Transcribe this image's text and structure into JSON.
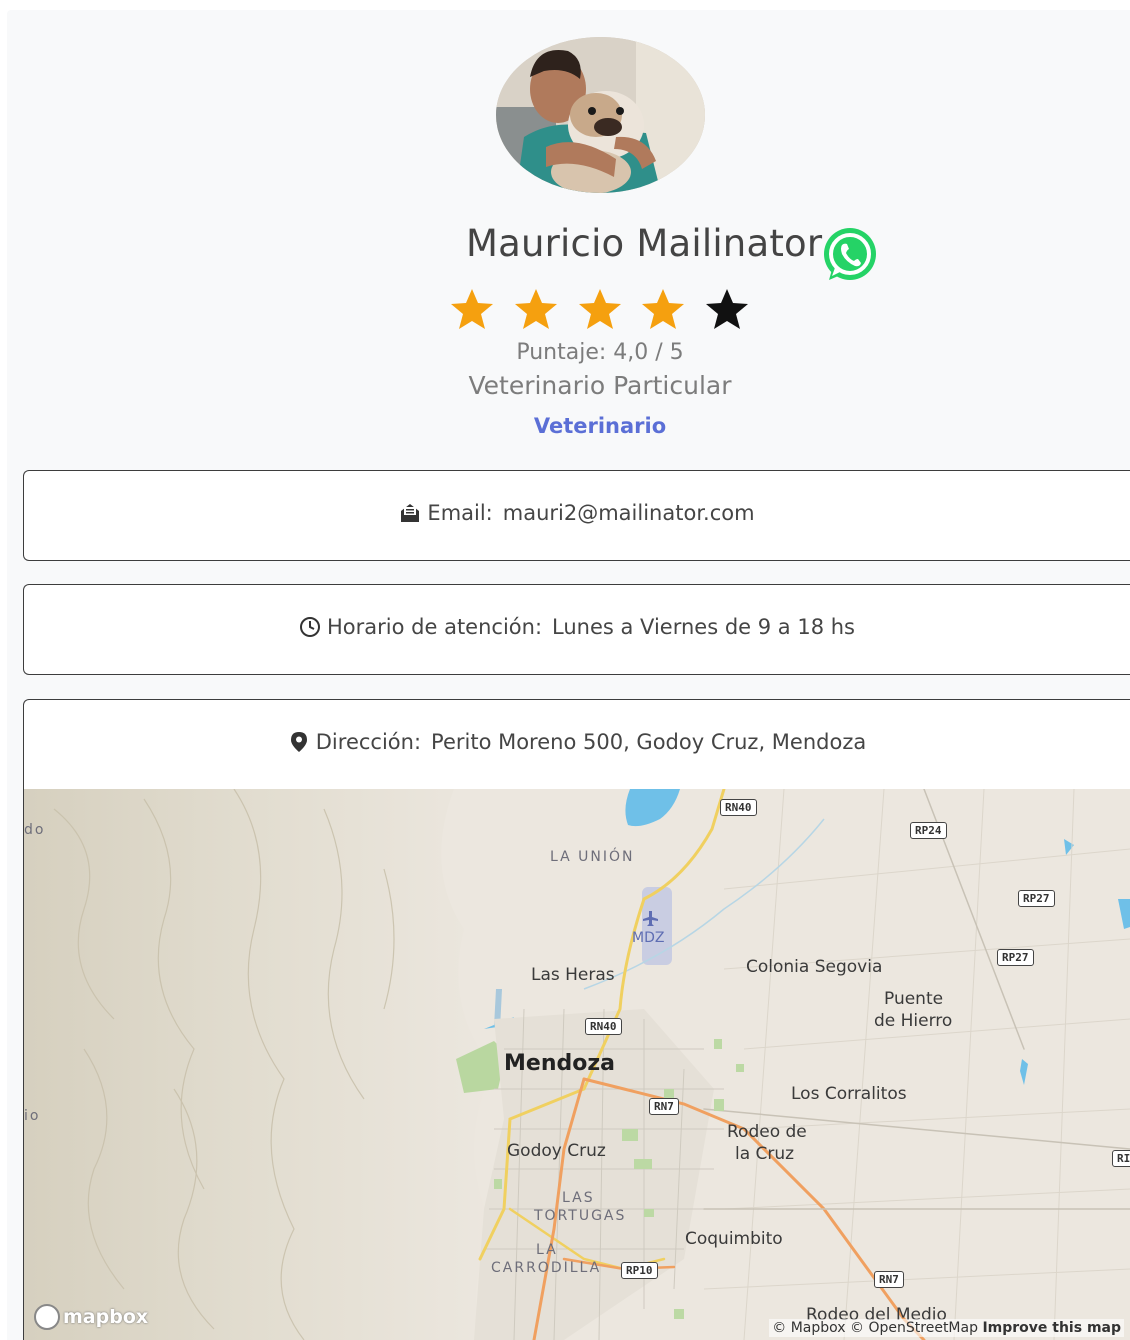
{
  "profile": {
    "name": "Mauricio Mailinator",
    "rating": 4,
    "rating_max": 5,
    "score_text": "Puntaje: 4,0 / 5",
    "profession": "Veterinario Particular",
    "category": "Veterinario"
  },
  "info": {
    "email_label": "Email:",
    "email_value": "mauri2@mailinator.com",
    "hours_label": "Horario de atención:",
    "hours_value": "Lunes a Viernes de 9 a 18 hs",
    "address_label": "Dirección:",
    "address_value": "Perito Moreno 500, Godoy Cruz, Mendoza"
  },
  "map": {
    "places": {
      "mendoza": "Mendoza",
      "las_heras": "Las Heras",
      "godoy_cruz": "Godoy Cruz",
      "colonia_segovia": "Colonia Segovia",
      "puente_de_hierro_1": "Puente",
      "puente_de_hierro_2": "de Hierro",
      "los_corralitos": "Los Corralitos",
      "rodeo_de_la_cruz_1": "Rodeo de",
      "rodeo_de_la_cruz_2": "la Cruz",
      "coquimbito": "Coquimbito",
      "rodeo_del_medio": "Rodeo del Medio",
      "la_union": "LA UNIÓN",
      "las_tortugas_1": "LAS",
      "las_tortugas_2": "TORTUGAS",
      "la_carrodilla_1": "LA",
      "la_carrodilla_2": "CARRODILLA",
      "airport": "MDZ",
      "edge_do": "do",
      "edge_io": "io"
    },
    "shields": {
      "rn40_top": "RN40",
      "rp24": "RP24",
      "rp27_a": "RP27",
      "rp27_b": "RP27",
      "rn40_mid": "RN40",
      "rn7_a": "RN7",
      "rn7_b": "RN7",
      "rp10": "RP10",
      "r_edge": "RI"
    },
    "logo": "mapbox",
    "attribution_mapbox": "© Mapbox",
    "attribution_osm": "© OpenStreetMap",
    "improve": "Improve this map"
  },
  "colors": {
    "star_filled": "#f5a00f",
    "star_empty": "#111111",
    "whatsapp": "#25d366",
    "category_link": "#5b6fd6"
  }
}
